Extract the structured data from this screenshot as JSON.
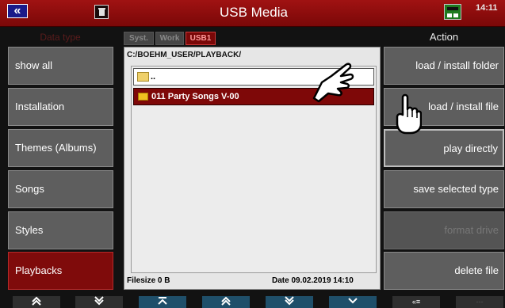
{
  "topbar": {
    "back_icon": "chevrons-left-icon",
    "trash_icon": "trash-icon",
    "title": "USB Media",
    "network_icon": "network-icon",
    "time": "14:11"
  },
  "headers": {
    "data_type": "Data type",
    "action": "Action"
  },
  "tabs": [
    {
      "label": "Syst."
    },
    {
      "label": "Work"
    },
    {
      "label": "USB1"
    }
  ],
  "data_types": [
    {
      "label": "show all"
    },
    {
      "label": "Installation"
    },
    {
      "label": "Themes (Albums)"
    },
    {
      "label": "Songs"
    },
    {
      "label": "Styles"
    },
    {
      "label": "Playbacks"
    }
  ],
  "browser": {
    "path": "C:/BOEHM_USER/PLAYBACK/",
    "up_item": "..",
    "items": [
      {
        "label": "011 Party Songs V-00"
      }
    ],
    "filesize": "Filesize  0 B",
    "date": "Date  09.02.2019   14:10"
  },
  "actions": [
    {
      "label": "load  /  install folder"
    },
    {
      "label": "load  /  install file"
    },
    {
      "label": "play directly"
    },
    {
      "label": "save  selected  type"
    },
    {
      "label": "format  drive"
    },
    {
      "label": "delete  file"
    }
  ],
  "bottom_nav": [
    {
      "label": "«",
      "icon": "double-chevron-up-icon"
    },
    {
      "label": "»",
      "icon": "double-chevron-down-icon"
    },
    {
      "label": "⌅",
      "icon": "jump-top-icon"
    },
    {
      "label": "«",
      "icon": "double-chevron-up-icon"
    },
    {
      "label": "»",
      "icon": "double-chevron-down-icon"
    },
    {
      "label": "⌄",
      "icon": "chevron-down-icon"
    },
    {
      "label": "«≡",
      "icon": "collapse-list-icon"
    },
    {
      "label": "---",
      "icon": "empty-icon"
    }
  ],
  "colors": {
    "accent_red": "#7f0b0b",
    "button_grey": "#5e5e5e",
    "background": "#121212"
  }
}
